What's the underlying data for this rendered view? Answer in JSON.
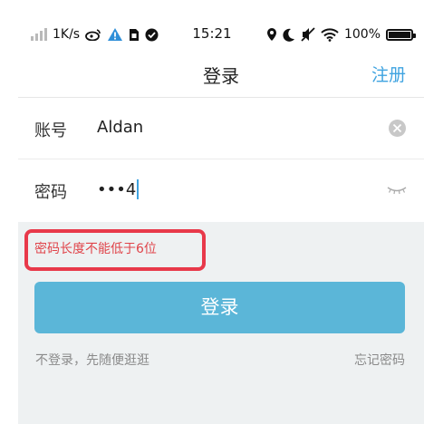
{
  "status_bar": {
    "speed": "1K/s",
    "time": "15:21",
    "battery": "100%",
    "icons_left": [
      "signal-icon",
      "weibo-icon",
      "warning-icon",
      "sim-icon",
      "check-circle-icon"
    ],
    "icons_right": [
      "location-icon",
      "moon-icon",
      "mute-icon",
      "wifi-icon",
      "battery-icon"
    ]
  },
  "header": {
    "title": "登录",
    "register": "注册"
  },
  "form": {
    "account_label": "账号",
    "account_value": "Aldan",
    "password_label": "密码",
    "password_dots": "•••",
    "password_last": "4"
  },
  "error": {
    "message": "密码长度不能低于6位"
  },
  "login_button": "登录",
  "links": {
    "skip": "不登录，先随便逛逛",
    "forgot": "忘记密码"
  },
  "colors": {
    "accent": "#3fa3e0",
    "button": "#5bb6d8",
    "error": "#e8394a",
    "panel_bg": "#eef1f2"
  }
}
